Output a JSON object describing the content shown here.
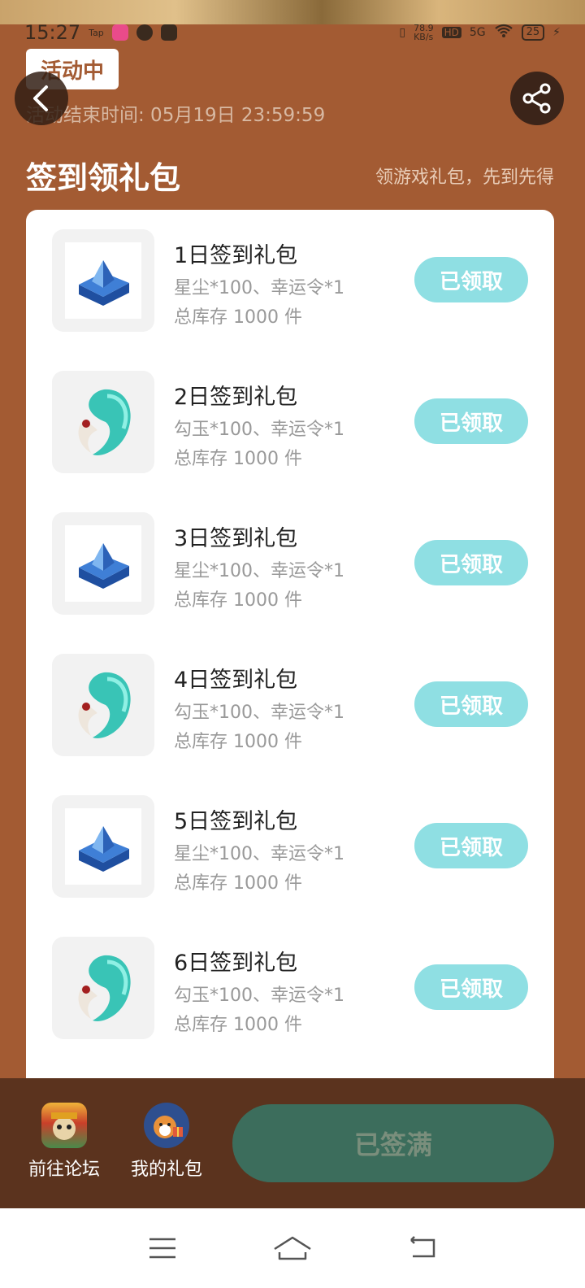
{
  "status": {
    "time": "15:27",
    "tap": "Tap",
    "speed": "78.9\nKB/s",
    "hd": "HD",
    "net": "5G",
    "battery": "25"
  },
  "header": {
    "badge": "活动中",
    "end_time": "活动结束时间: 05月19日 23:59:59",
    "section_title": "签到领礼包",
    "section_subtitle": "领游戏礼包，先到先得"
  },
  "gifts": [
    {
      "name": "1日签到礼包",
      "desc": "星尘*100、幸运令*1",
      "stock": "总库存 1000 件",
      "button": "已领取",
      "icon": "stardust-chest-icon"
    },
    {
      "name": "2日签到礼包",
      "desc": "勾玉*100、幸运令*1",
      "stock": "总库存 1000 件",
      "button": "已领取",
      "icon": "magatama-icon"
    },
    {
      "name": "3日签到礼包",
      "desc": "星尘*100、幸运令*1",
      "stock": "总库存 1000 件",
      "button": "已领取",
      "icon": "stardust-chest-icon"
    },
    {
      "name": "4日签到礼包",
      "desc": "勾玉*100、幸运令*1",
      "stock": "总库存 1000 件",
      "button": "已领取",
      "icon": "magatama-icon"
    },
    {
      "name": "5日签到礼包",
      "desc": "星尘*100、幸运令*1",
      "stock": "总库存 1000 件",
      "button": "已领取",
      "icon": "stardust-chest-icon"
    },
    {
      "name": "6日签到礼包",
      "desc": "勾玉*100、幸运令*1",
      "stock": "总库存 1000 件",
      "button": "已领取",
      "icon": "magatama-icon"
    }
  ],
  "bottom": {
    "forum_label": "前往论坛",
    "my_gifts_label": "我的礼包",
    "signed_button": "已签满"
  },
  "colors": {
    "background": "#a35b33",
    "claimed_button": "#8fdfe3",
    "bottom_bar": "#5b331e",
    "signed_button": "#3c6d5c"
  }
}
